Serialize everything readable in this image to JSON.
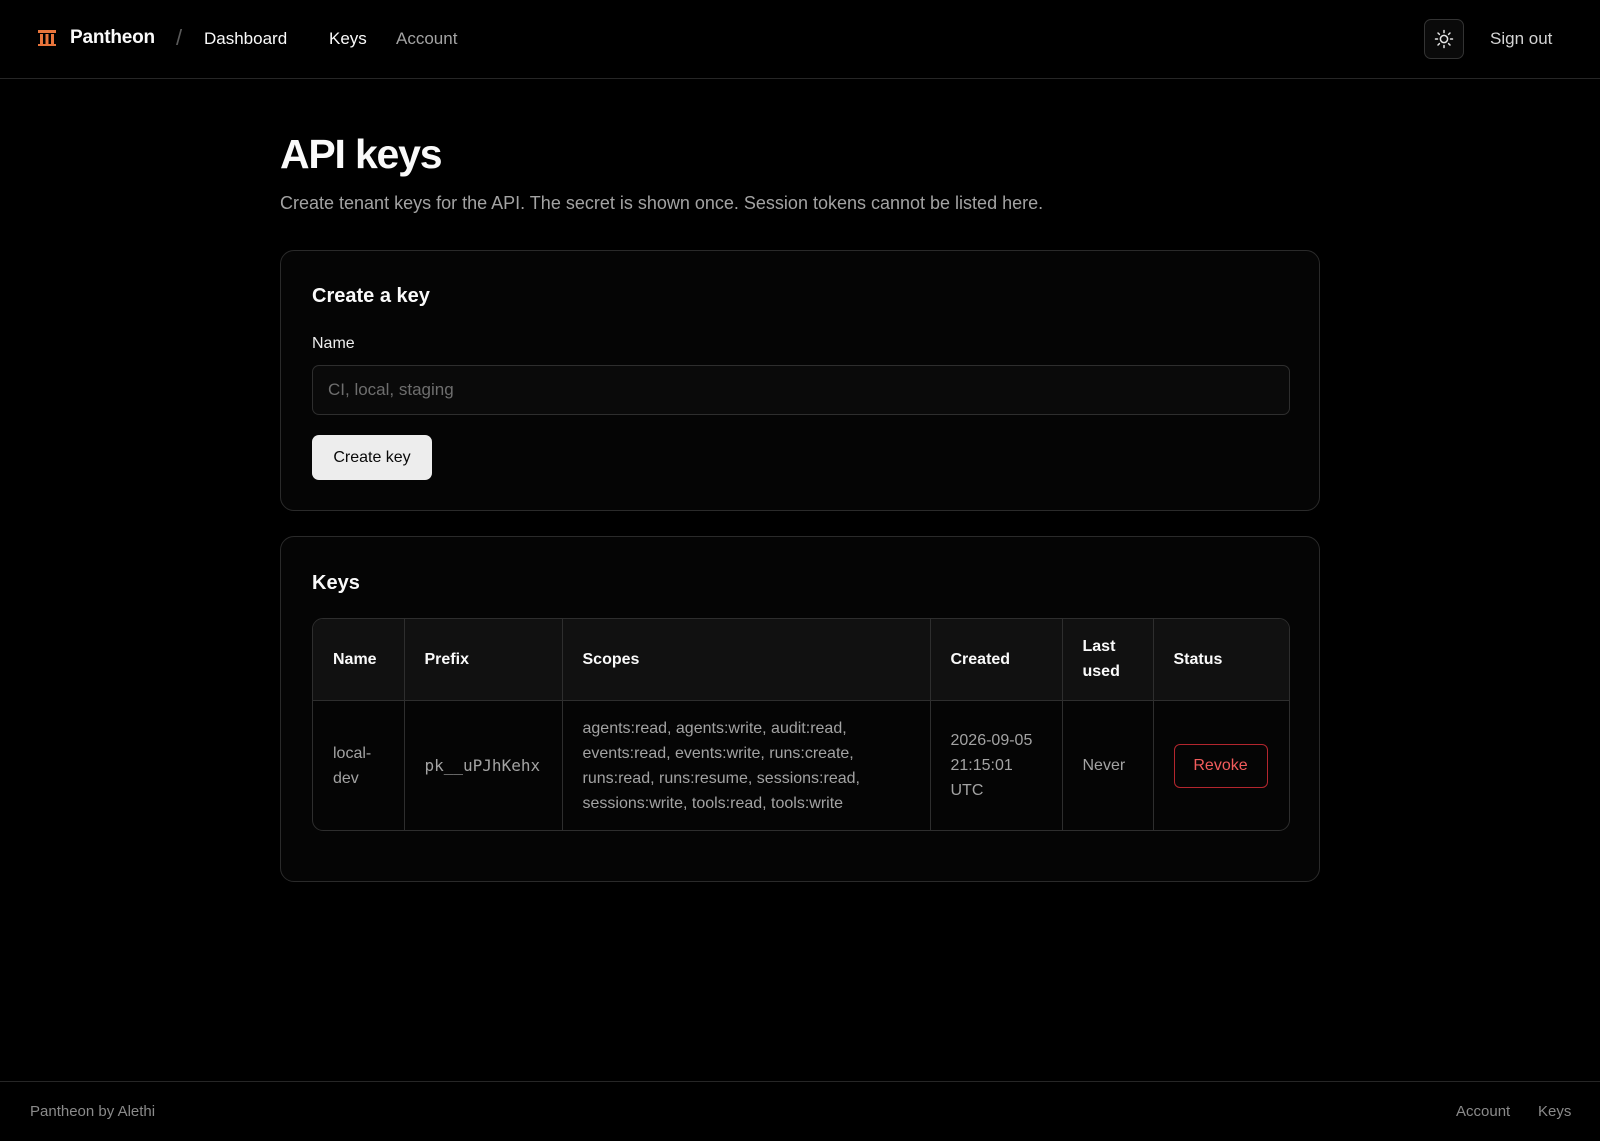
{
  "header": {
    "brand_name": "Pantheon",
    "brand_icon": "columns-icon",
    "brand_color": "#e8743b",
    "breadcrumb_separator": "/",
    "breadcrumb": "Dashboard",
    "nav": [
      {
        "label": "Keys",
        "active": true
      },
      {
        "label": "Account",
        "active": false
      }
    ],
    "theme_toggle_icon": "sun-icon",
    "sign_out_label": "Sign out"
  },
  "page": {
    "title": "API keys",
    "subtitle": "Create tenant keys for the API. The secret is shown once. Session tokens cannot be listed here."
  },
  "create_card": {
    "title": "Create a key",
    "name_label": "Name",
    "name_value": "",
    "name_placeholder": "CI, local, staging",
    "submit_label": "Create key"
  },
  "keys_card": {
    "title": "Keys",
    "columns": [
      "Name",
      "Prefix",
      "Scopes",
      "Created",
      "Last used",
      "Status"
    ],
    "rows": [
      {
        "name": "local-dev",
        "prefix": "pk__uPJhKehx",
        "scopes": "agents:read, agents:write, audit:read, events:read, events:write, runs:create, runs:read, runs:resume, sessions:read, sessions:write, tools:read, tools:write",
        "created": "2026-09-05 21:15:01 UTC",
        "last_used": "Never",
        "status_action": "Revoke"
      }
    ],
    "revoke_color": "#f25c5c"
  },
  "footer": {
    "brand": "Pantheon by Alethi",
    "links": [
      "Account",
      "Keys"
    ]
  }
}
